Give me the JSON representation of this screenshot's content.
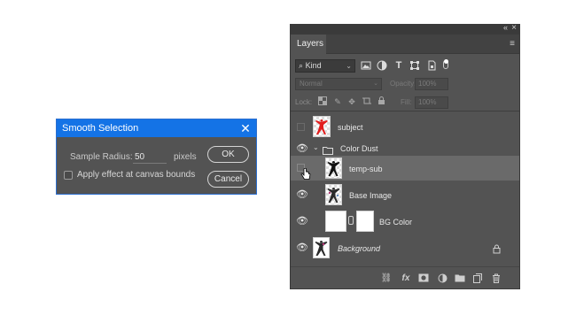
{
  "dialog": {
    "title": "Smooth Selection",
    "sample_radius_label": "Sample Radius:",
    "sample_radius_value": "50",
    "unit": "pixels",
    "ok_label": "OK",
    "cancel_label": "Cancel",
    "canvas_bounds_label": "Apply effect at canvas bounds",
    "canvas_bounds_checked": false
  },
  "layers_panel": {
    "tab": "Layers",
    "filter_kind": "Kind",
    "blend_mode": "Normal",
    "opacity_label": "Opacity:",
    "opacity_value": "100%",
    "lock_label": "Lock:",
    "fill_label": "Fill:",
    "fill_value": "100%",
    "layers": [
      {
        "name": "subject",
        "visible": false
      },
      {
        "name": "Color Dust",
        "type": "group",
        "visible": true
      },
      {
        "name": "temp-sub",
        "visible": false,
        "selected": true
      },
      {
        "name": "Base Image",
        "visible": true
      },
      {
        "name": "BG Color",
        "visible": true
      },
      {
        "name": "Background",
        "visible": true,
        "locked": true
      }
    ]
  }
}
